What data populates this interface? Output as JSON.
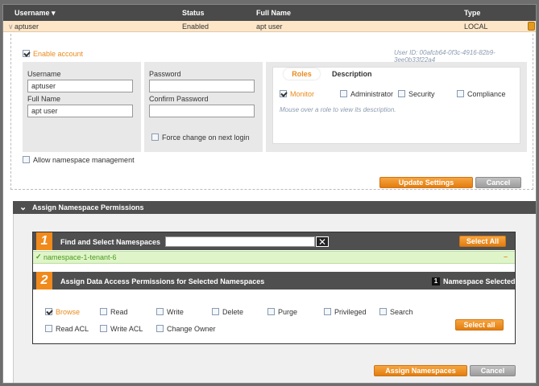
{
  "table": {
    "headers": {
      "username": "Username",
      "status": "Status",
      "fullname": "Full Name",
      "type": "Type"
    },
    "row": {
      "username": "aptuser",
      "status": "Enabled",
      "fullname": "apt user",
      "type": "LOCAL"
    }
  },
  "account": {
    "enable_label": "Enable account",
    "user_id": "User ID: 00afcb64-0f3c-4916-82b9-3ee0b33f22a4",
    "username_label": "Username",
    "username_value": "aptuser",
    "fullname_label": "Full Name",
    "fullname_value": "apt user",
    "password_label": "Password",
    "confirm_label": "Confirm Password",
    "force_change_label": "Force change on next login",
    "allow_ns_label": "Allow namespace management"
  },
  "roles": {
    "tab_roles": "Roles",
    "tab_description": "Description",
    "items": [
      "Monitor",
      "Administrator",
      "Security",
      "Compliance"
    ],
    "hint": "Mouse over a role to view its description."
  },
  "buttons": {
    "update": "Update Settings",
    "cancel": "Cancel",
    "select_all": "Select All",
    "select_all_2": "Select all",
    "assign": "Assign Namespaces",
    "cancel2": "Cancel"
  },
  "assign": {
    "section_title": "Assign Namespace Permissions",
    "step1_num": "1",
    "step1_title": "Find and Select Namespaces",
    "namespace_item": "namespace-1-tenant-6",
    "step2_num": "2",
    "step2_title": "Assign Data Access Permissions for Selected Namespaces",
    "selected_count": "1",
    "selected_label": "Namespace Selected",
    "perms_row1": [
      "Browse",
      "Read",
      "Write",
      "Delete",
      "Purge",
      "Privileged",
      "Search"
    ],
    "perms_row2": [
      "Read ACL",
      "Write ACL",
      "Change Owner"
    ],
    "remove_symbol": "–"
  },
  "colors": {
    "accent": "#e98a1c",
    "header": "#4a4a4a",
    "selected_bg": "#dff5c9"
  }
}
